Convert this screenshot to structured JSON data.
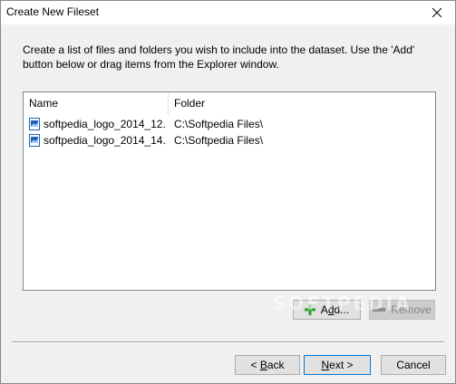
{
  "window": {
    "title": "Create New Fileset"
  },
  "intro": {
    "text": "Create a list of files and folders you wish to include into the dataset. Use the 'Add' button below or drag items from the Explorer window."
  },
  "list": {
    "columns": [
      "Name",
      "Folder"
    ],
    "rows": [
      {
        "name": "softpedia_logo_2014_12...",
        "folder": "C:\\Softpedia Files\\"
      },
      {
        "name": "softpedia_logo_2014_14...",
        "folder": "C:\\Softpedia Files\\"
      }
    ]
  },
  "buttons": {
    "add_prefix": "A",
    "add_accel": "d",
    "add_suffix": "d...",
    "remove_label": "Remove",
    "back_prefix": "< ",
    "back_accel": "B",
    "back_suffix": "ack",
    "next_accel": "N",
    "next_suffix": "ext >",
    "cancel_label": "Cancel"
  },
  "watermark": {
    "text": "SOFTPEDIA"
  },
  "colors": {
    "dialog_bg": "#f0f0f0",
    "default_button_border": "#0078d7",
    "add_icon_green": "#2fa12f",
    "file_icon_blue": "#1f5fb4"
  },
  "icons": {
    "close": "close-icon",
    "file": "image-file-icon",
    "add": "plus-icon",
    "remove": "minus-icon"
  }
}
